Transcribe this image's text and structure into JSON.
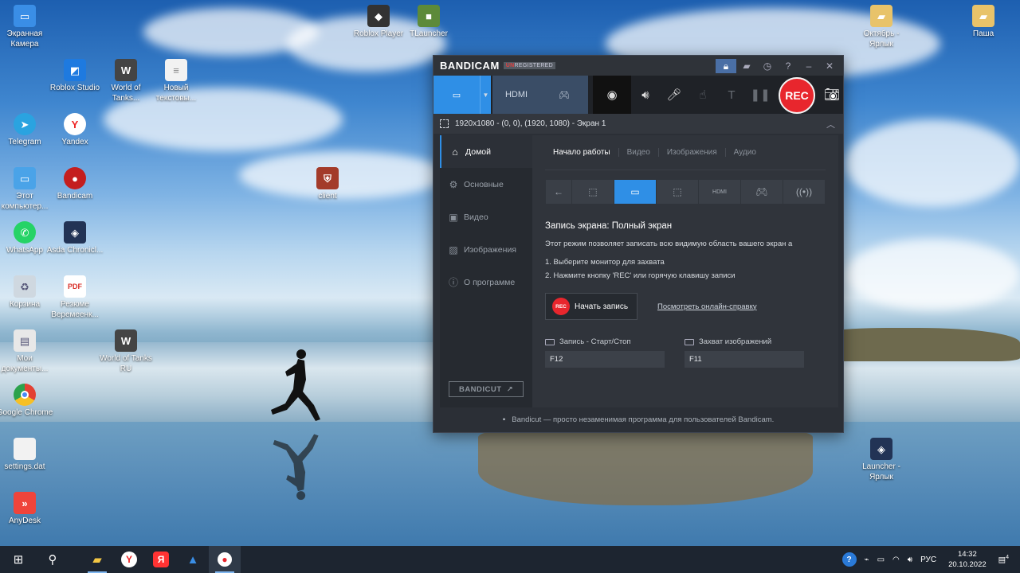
{
  "desktop": {
    "icons": [
      {
        "label": "Экранная Камера",
        "icon": "screen-camera-icon",
        "color": "#3a8ee6"
      },
      {
        "label": "Roblox Player",
        "icon": "roblox-icon",
        "color": "#333333"
      },
      {
        "label": "TLauncher",
        "icon": "tlauncher-icon",
        "color": "#5d8a3a"
      },
      {
        "label": "Roblox Studio",
        "icon": "roblox-studio-icon",
        "color": "#1e7ae0"
      },
      {
        "label": "World of Tanks...",
        "icon": "world-of-tanks-icon",
        "color": "#444444"
      },
      {
        "label": "Новый текстовы...",
        "icon": "text-file-icon",
        "color": "#f2f2f2"
      },
      {
        "label": "Telegram",
        "icon": "telegram-icon",
        "color": "#2aa3e0"
      },
      {
        "label": "Yandex",
        "icon": "yandex-icon",
        "color": "#ffffff"
      },
      {
        "label": "Этот компьютер...",
        "icon": "this-pc-icon",
        "color": "#4aa3e8"
      },
      {
        "label": "Bandicam",
        "icon": "bandicam-icon",
        "color": "#c41e1e"
      },
      {
        "label": "client",
        "icon": "client-icon",
        "color": "#a33b2a"
      },
      {
        "label": "WhatsApp",
        "icon": "whatsapp-icon",
        "color": "#25d366"
      },
      {
        "label": "Asda Chronicl...",
        "icon": "asda-icon",
        "color": "#223355"
      },
      {
        "label": "Корзина",
        "icon": "recycle-bin-icon",
        "color": "#cfd8e0"
      },
      {
        "label": "Резюме Веремеенк...",
        "icon": "pdf-icon",
        "color": "#d9322b"
      },
      {
        "label": "Мои документы...",
        "icon": "documents-icon",
        "color": "#e8e8e8"
      },
      {
        "label": "World of Tanks RU",
        "icon": "world-of-tanks-ru-icon",
        "color": "#444444"
      },
      {
        "label": "Google Chrome",
        "icon": "chrome-icon",
        "color": "#e34133"
      },
      {
        "label": "settings.dat",
        "icon": "file-icon",
        "color": "#f2f2f2"
      },
      {
        "label": "AnyDesk",
        "icon": "anydesk-icon",
        "color": "#ef443b"
      },
      {
        "label": "Октябрь - Ярлык",
        "icon": "folder-icon",
        "color": "#e8c36a"
      },
      {
        "label": "Паша",
        "icon": "user-folder-icon",
        "color": "#e8c36a"
      },
      {
        "label": "Launcher - Ярлык",
        "icon": "launcher-icon",
        "color": "#223355"
      }
    ]
  },
  "bandicam": {
    "brand": "BANDICAM",
    "unregistered_prefix": "UN",
    "unregistered_rest": "REGISTERED",
    "title_buttons": [
      "lock-icon",
      "folder-icon",
      "clock-icon",
      "help-icon",
      "minimize-icon",
      "close-icon"
    ],
    "rec_label": "REC",
    "area_text": "1920x1080 - (0, 0), (1920, 1080) - Экран 1",
    "sidebar": [
      {
        "label": "Домой",
        "icon": "home-icon",
        "active": true
      },
      {
        "label": "Основные",
        "icon": "gear-icon",
        "active": false
      },
      {
        "label": "Видео",
        "icon": "video-icon",
        "active": false
      },
      {
        "label": "Изображения",
        "icon": "image-icon",
        "active": false
      },
      {
        "label": "О программе",
        "icon": "info-icon",
        "active": false
      }
    ],
    "bandicut_label": "BANDICUT",
    "tabs": [
      "Начало работы",
      "Видео",
      "Изображения",
      "Аудио"
    ],
    "section_title": "Запись экрана: Полный экран",
    "description": "Этот режим позволяет записать всю видимую область вашего экран а",
    "steps": [
      "1. Выберите монитор для захвата",
      "2. Нажмите кнопку 'REC' или горячую клавишу записи"
    ],
    "start_button_badge": "REC",
    "start_button_label": "Начать запись",
    "help_link": "Посмотреть онлайн-справку",
    "hotkeys": [
      {
        "label": "Запись - Старт/Стоп",
        "value": "F12"
      },
      {
        "label": "Захват изображений",
        "value": "F11"
      }
    ],
    "footer": "Bandicut — просто незаменимая программа для пользователей Bandicam."
  },
  "taskbar": {
    "language": "РУС",
    "time": "14:32",
    "date": "20.10.2022",
    "notification_count": "4"
  }
}
